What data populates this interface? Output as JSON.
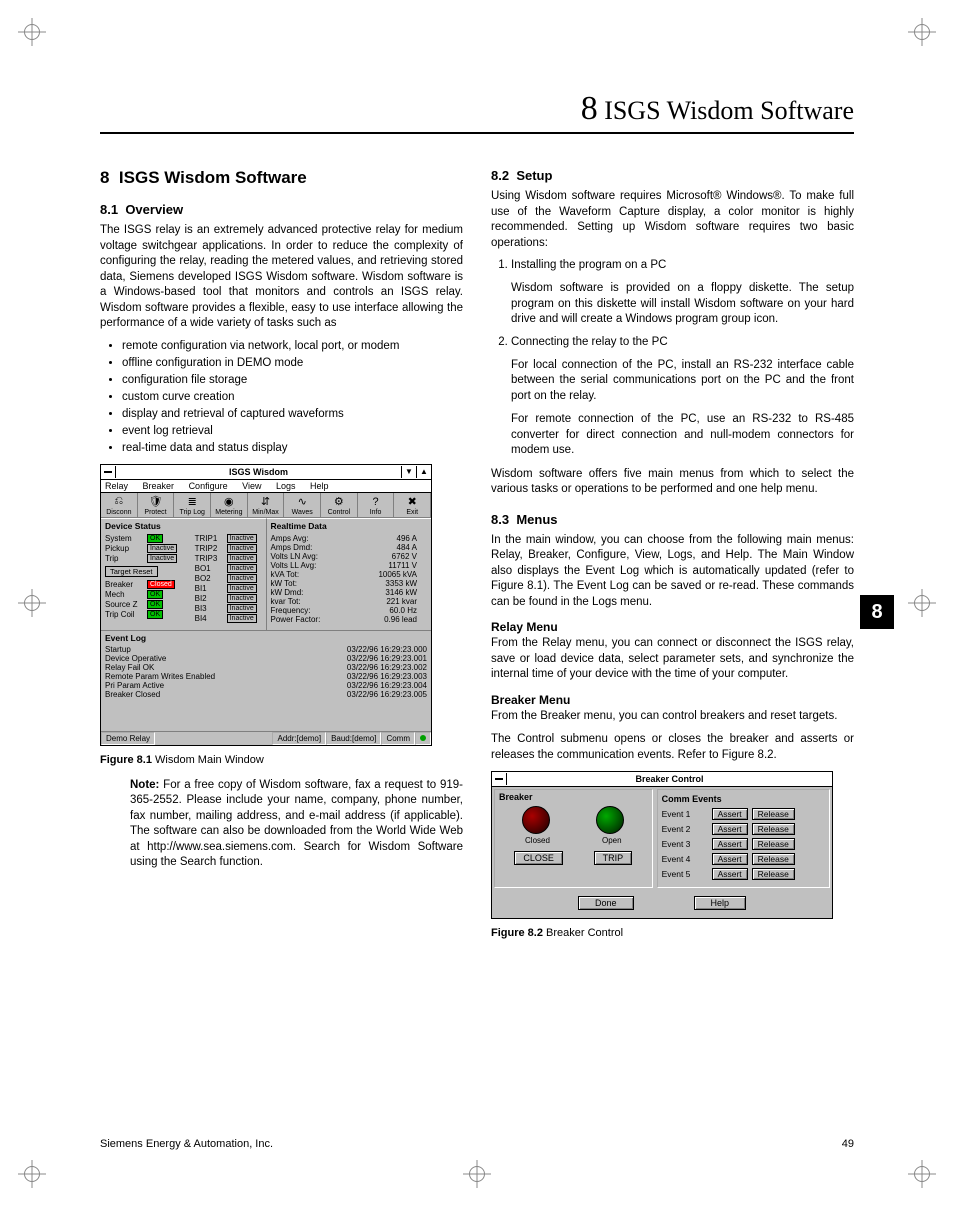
{
  "running_head": {
    "num": "8",
    "text": "ISGS Wisdom Software"
  },
  "section": {
    "num": "8",
    "title": "ISGS Wisdom Software"
  },
  "s81": {
    "num": "8.1",
    "title": "Overview",
    "p1": "The ISGS relay is an extremely advanced protective relay for medium voltage switchgear applications. In order to reduce the complexity of configuring the relay, reading the metered values, and retrieving stored data, Siemens developed ISGS Wisdom software. Wisdom software is a Windows-based tool that monitors and controls an ISGS relay. Wisdom software provides a flexible, easy to use interface allowing the performance of a wide variety of tasks such as",
    "bullets": [
      "remote configuration via network, local port, or modem",
      "offline configuration in DEMO mode",
      "configuration file storage",
      "custom curve creation",
      "display and retrieval of captured waveforms",
      "event log retrieval",
      "real-time data and status display"
    ]
  },
  "fig81": {
    "label": "Figure 8.1",
    "caption": "Wisdom Main Window"
  },
  "note": {
    "lead": "Note:",
    "body": "For a free copy of Wisdom software, fax a request to 919-365-2552. Please include your name, company, phone number, fax number, mailing address, and e-mail address (if applicable). The software can also be downloaded from the World Wide Web at http://www.sea.siemens.com. Search for Wisdom Software using the Search function."
  },
  "s82": {
    "num": "8.2",
    "title": "Setup",
    "p1": "Using Wisdom software requires Microsoft® Windows®. To make full use of the Waveform Capture display, a color monitor is highly recommended. Setting up Wisdom software requires two basic operations:",
    "li1": "Installing the program on a PC",
    "li1b": "Wisdom software is provided on a floppy diskette. The setup program on this diskette will install Wisdom software on your hard drive and will create a Windows program group icon.",
    "li2": "Connecting the relay to the PC",
    "li2b": "For local connection of the PC, install an RS-232 interface cable between the serial communications port on the PC and the front port on the relay.",
    "li2c": "For remote connection of the PC, use an RS-232 to RS-485 converter for direct connection and null-modem connectors for modem use.",
    "p2": "Wisdom software offers five main menus from which to select the various tasks or operations to be performed and one help menu."
  },
  "s83": {
    "num": "8.3",
    "title": "Menus",
    "p1": "In the main window, you can choose from the following main menus: Relay, Breaker, Configure, View, Logs, and Help. The Main Window also displays the Event Log which is automatically updated (refer to Figure 8.1). The Event Log can be saved or re-read. These commands can be found in the Logs menu.",
    "relay_h": "Relay Menu",
    "relay_p": "From the Relay menu, you can connect or disconnect the ISGS relay, save or load device data, select parameter sets, and synchronize the internal time of your device with the time of your computer.",
    "brk_h": "Breaker Menu",
    "brk_p1": "From the Breaker menu, you can control breakers and reset targets.",
    "brk_p2": "The Control submenu opens or closes the breaker and asserts or releases the communication events. Refer to Figure 8.2."
  },
  "fig82": {
    "label": "Figure 8.2",
    "caption": "Breaker Control"
  },
  "tab": "8",
  "footer": {
    "left": "Siemens Energy & Automation, Inc.",
    "right": "49"
  },
  "win81": {
    "title": "ISGS Wisdom",
    "menus": [
      "Relay",
      "Breaker",
      "Configure",
      "View",
      "Logs",
      "Help"
    ],
    "toolbar": [
      "Disconn",
      "Protect",
      "Trip Log",
      "Metering",
      "Min/Max",
      "Waves",
      "Control",
      "Info",
      "Exit"
    ],
    "device_status_title": "Device Status",
    "ds_left": [
      {
        "lbl": "System",
        "pill": "OK",
        "cls": "ok"
      },
      {
        "lbl": "Pickup",
        "pill": "Inactive",
        "cls": "in"
      },
      {
        "lbl": "Trip",
        "pill": "Inactive",
        "cls": "in"
      }
    ],
    "target_reset": "Target Reset",
    "ds_left2": [
      {
        "lbl": "Breaker",
        "pill": "Closed",
        "cls": "cl"
      },
      {
        "lbl": "Mech",
        "pill": "OK",
        "cls": "ok"
      },
      {
        "lbl": "Source Z",
        "pill": "OK",
        "cls": "ok"
      },
      {
        "lbl": "Trip Coil",
        "pill": "OK",
        "cls": "ok"
      }
    ],
    "ds_right": [
      {
        "lbl": "TRIP1",
        "pill": "Inactive"
      },
      {
        "lbl": "TRIP2",
        "pill": "Inactive"
      },
      {
        "lbl": "TRIP3",
        "pill": "Inactive"
      },
      {
        "lbl": "BO1",
        "pill": "Inactive"
      },
      {
        "lbl": "BO2",
        "pill": "Inactive"
      },
      {
        "lbl": "BI1",
        "pill": "Inactive"
      },
      {
        "lbl": "BI2",
        "pill": "Inactive"
      },
      {
        "lbl": "BI3",
        "pill": "Inactive"
      },
      {
        "lbl": "BI4",
        "pill": "Inactive"
      }
    ],
    "realtime_title": "Realtime Data",
    "realtime": [
      {
        "k": "Amps Avg:",
        "v": "496 A"
      },
      {
        "k": "Amps Dmd:",
        "v": "484 A"
      },
      {
        "k": "Volts LN Avg:",
        "v": "6762 V"
      },
      {
        "k": "Volts LL Avg:",
        "v": "11711 V"
      },
      {
        "k": "kVA Tot:",
        "v": "10065 kVA"
      },
      {
        "k": "kW Tot:",
        "v": "3353 kW"
      },
      {
        "k": "kW Dmd:",
        "v": "3146 kW"
      },
      {
        "k": "kvar Tot:",
        "v": "221 kvar"
      },
      {
        "k": "Frequency:",
        "v": "60.0 Hz"
      },
      {
        "k": "Power Factor:",
        "v": "0.96 lead"
      }
    ],
    "eventlog_title": "Event Log",
    "events": [
      {
        "e": "Startup",
        "t": "03/22/96 16:29:23.000"
      },
      {
        "e": "Device Operative",
        "t": "03/22/96 16:29:23.001"
      },
      {
        "e": "Relay Fail OK",
        "t": "03/22/96 16:29:23.002"
      },
      {
        "e": "Remote Param Writes Enabled",
        "t": "03/22/96 16:29:23.003"
      },
      {
        "e": "Pri Param Active",
        "t": "03/22/96 16:29:23.004"
      },
      {
        "e": "Breaker Closed",
        "t": "03/22/96 16:29:23.005"
      }
    ],
    "status": {
      "relay": "Demo Relay",
      "addr": "Addr:[demo]",
      "baud": "Baud:[demo]",
      "comm": "Comm"
    }
  },
  "win82": {
    "title": "Breaker Control",
    "breaker_hdr": "Breaker",
    "closed": "Closed",
    "open": "Open",
    "close_btn": "CLOSE",
    "trip_btn": "TRIP",
    "comm_hdr": "Comm Events",
    "events": [
      {
        "n": "Event 1",
        "a": "Assert",
        "r": "Release"
      },
      {
        "n": "Event 2",
        "a": "Assert",
        "r": "Release"
      },
      {
        "n": "Event 3",
        "a": "Assert",
        "r": "Release"
      },
      {
        "n": "Event 4",
        "a": "Assert",
        "r": "Release"
      },
      {
        "n": "Event 5",
        "a": "Assert",
        "r": "Release"
      }
    ],
    "done": "Done",
    "help": "Help"
  }
}
